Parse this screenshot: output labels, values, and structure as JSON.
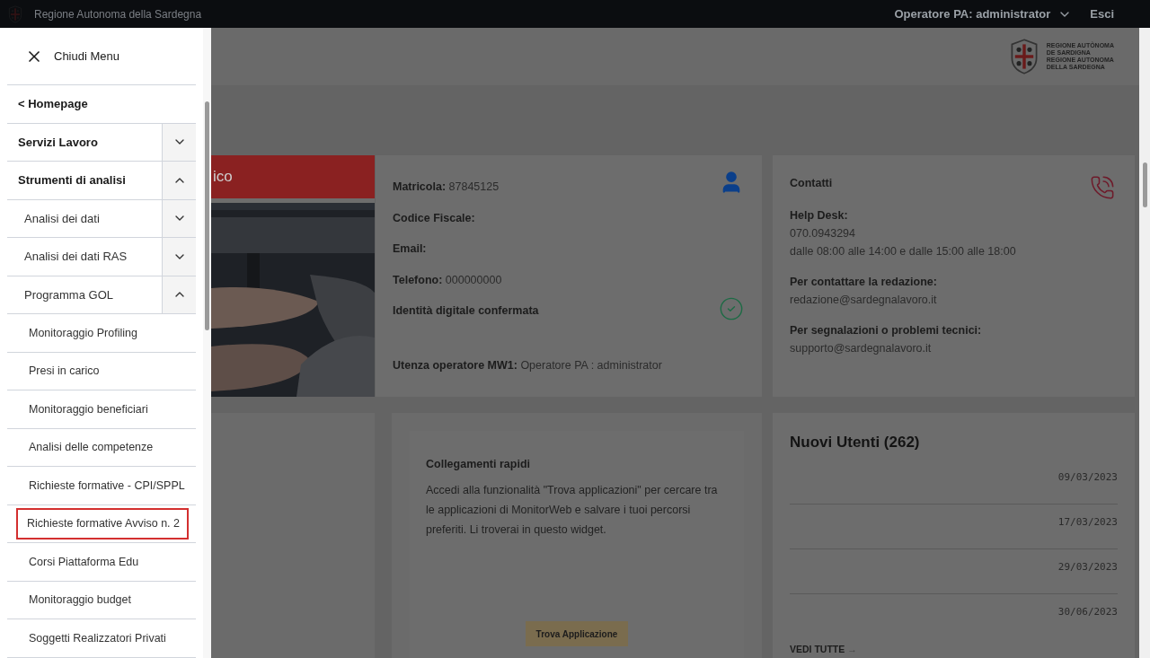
{
  "topbar": {
    "site": "Regione Autonoma della Sardegna",
    "user": "Operatore PA: administrator",
    "logout": "Esci"
  },
  "header": {
    "logo_lines": [
      "REGIONE AUTÒNOMA",
      "DE SARDIGNA",
      "REGIONE AUTONOMA",
      "DELLA SARDEGNA"
    ]
  },
  "menu": {
    "close": "Chiudi Menu",
    "items": [
      {
        "kind": "link",
        "label": "< Homepage"
      },
      {
        "kind": "group",
        "label": "Servizi Lavoro",
        "expanded": false
      },
      {
        "kind": "group",
        "label": "Strumenti di analisi",
        "expanded": true,
        "children": [
          {
            "kind": "group",
            "label": "Analisi dei dati",
            "expanded": false
          },
          {
            "kind": "group",
            "label": "Analisi dei dati RAS",
            "expanded": false
          },
          {
            "kind": "group",
            "label": "Programma GOL",
            "expanded": true,
            "children": [
              {
                "kind": "leaf",
                "label": "Monitoraggio Profiling",
                "selected": false
              },
              {
                "kind": "leaf",
                "label": "Presi in carico",
                "selected": false
              },
              {
                "kind": "leaf",
                "label": "Monitoraggio beneficiari",
                "selected": false
              },
              {
                "kind": "leaf",
                "label": "Analisi delle competenze",
                "selected": false
              },
              {
                "kind": "leaf",
                "label": "Richieste formative - CPI/SPPL",
                "selected": false
              },
              {
                "kind": "leaf",
                "label": "Richieste formative Avviso n. 2",
                "selected": true
              },
              {
                "kind": "leaf",
                "label": "Corsi Piattaforma Edu",
                "selected": false
              },
              {
                "kind": "leaf",
                "label": "Monitoraggio budget",
                "selected": false
              },
              {
                "kind": "leaf",
                "label": "Soggetti Realizzatori Privati",
                "selected": false
              }
            ]
          }
        ]
      }
    ]
  },
  "banner": {
    "title": "ico"
  },
  "profile": {
    "fields": [
      {
        "label": "Matricola:",
        "value": "87845125"
      },
      {
        "label": "Codice Fiscale:"
      },
      {
        "label": "Email:"
      },
      {
        "label": "Telefono:",
        "value": "000000000"
      },
      {
        "label": "Identità digitale confermata"
      }
    ],
    "operator": {
      "label": "Utenza operatore MW1:",
      "value": "Operatore PA : administrator"
    }
  },
  "contacts": {
    "title": "Contatti",
    "sections": [
      {
        "label": "Help Desk:",
        "lines": [
          "070.0943294",
          "dalle 08:00 alle 14:00 e dalle 15:00 alle 18:00"
        ]
      },
      {
        "label": "Per contattare la redazione:",
        "lines": [
          "redazione@sardegnalavoro.it"
        ]
      },
      {
        "label": "Per segnalazioni o problemi tecnici:",
        "lines": [
          "supporto@sardegnalavoro.it"
        ]
      }
    ]
  },
  "quick_links": {
    "title": "Collegamenti rapidi",
    "text": "Accedi alla funzionalità \"Trova applicazioni\" per cercare tra le applicazioni di MonitorWeb e salvare i tuoi percorsi preferiti. Li troverai in questo widget.",
    "button": "Trova Applicazione"
  },
  "new_users": {
    "title": "Nuovi Utenti (262)",
    "dates": [
      "09/03/2023",
      "17/03/2023",
      "29/03/2023",
      "30/06/2023"
    ],
    "more": "VEDI TUTTE",
    "more_arrow": "→"
  }
}
